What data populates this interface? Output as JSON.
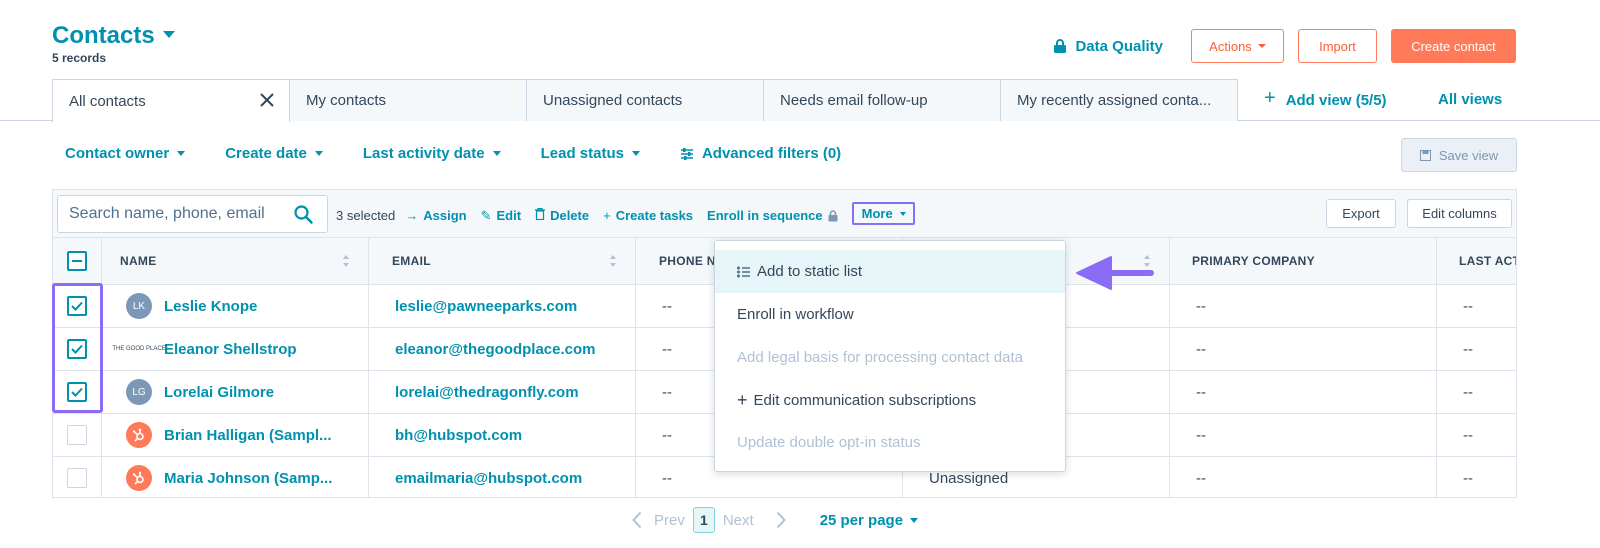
{
  "header": {
    "title": "Contacts",
    "record_count": "5 records",
    "data_quality_label": "Data Quality",
    "actions_label": "Actions",
    "import_label": "Import",
    "create_contact_label": "Create contact"
  },
  "tabs": [
    {
      "label": "All contacts",
      "active": true
    },
    {
      "label": "My contacts"
    },
    {
      "label": "Unassigned contacts"
    },
    {
      "label": "Needs email follow-up"
    },
    {
      "label": "My recently assigned conta..."
    }
  ],
  "add_view_label": "Add view (5/5)",
  "all_views_label": "All views",
  "filters": {
    "contact_owner": "Contact owner",
    "create_date": "Create date",
    "last_activity_date": "Last activity date",
    "lead_status": "Lead status",
    "advanced_filters": "Advanced filters (0)"
  },
  "save_view_label": "Save view",
  "toolbar": {
    "search_placeholder": "Search name, phone, email",
    "selected_text": "3 selected",
    "assign": "Assign",
    "edit": "Edit",
    "delete": "Delete",
    "create_tasks": "Create tasks",
    "enroll_in_sequence": "Enroll in sequence",
    "more": "More",
    "export": "Export",
    "edit_columns": "Edit columns"
  },
  "columns": {
    "name": "NAME",
    "email": "EMAIL",
    "phone": "PHONE N",
    "primary_company": "PRIMARY COMPANY",
    "last_activity": "LAST ACT"
  },
  "rows": [
    {
      "initials": "LK",
      "name": "Leslie Knope",
      "email": "leslie@pawneeparks.com",
      "phone": "--",
      "owner": "",
      "company": "--",
      "last": "--",
      "checked": true
    },
    {
      "initials": "THE GOOD PLACE",
      "name": "Eleanor Shellstrop",
      "email": "eleanor@thegoodplace.com",
      "phone": "--",
      "owner": "",
      "company": "--",
      "last": "--",
      "checked": true
    },
    {
      "initials": "LG",
      "name": "Lorelai Gilmore",
      "email": "lorelai@thedragonfly.com",
      "phone": "--",
      "owner": "",
      "company": "--",
      "last": "--",
      "checked": true
    },
    {
      "initials": "",
      "name": "Brian Halligan (Sampl...",
      "email": "bh@hubspot.com",
      "phone": "--",
      "owner": "",
      "company": "--",
      "last": "--",
      "checked": false
    },
    {
      "initials": "",
      "name": "Maria Johnson (Samp...",
      "email": "emailmaria@hubspot.com",
      "phone": "--",
      "owner": "Unassigned",
      "company": "--",
      "last": "--",
      "checked": false
    }
  ],
  "more_menu": [
    {
      "label": "Add to static list",
      "highlighted": true
    },
    {
      "label": "Enroll in workflow"
    },
    {
      "label": "Add legal basis for processing contact data",
      "disabled": true
    },
    {
      "label": "Edit communication subscriptions"
    },
    {
      "label": "Update double opt-in status",
      "disabled": true
    }
  ],
  "pagination": {
    "prev": "Prev",
    "page": "1",
    "next": "Next",
    "per_page": "25 per page"
  },
  "colors": {
    "accent": "#0091ae",
    "brand": "#ff7a59",
    "annotation": "#8b6cf7"
  }
}
